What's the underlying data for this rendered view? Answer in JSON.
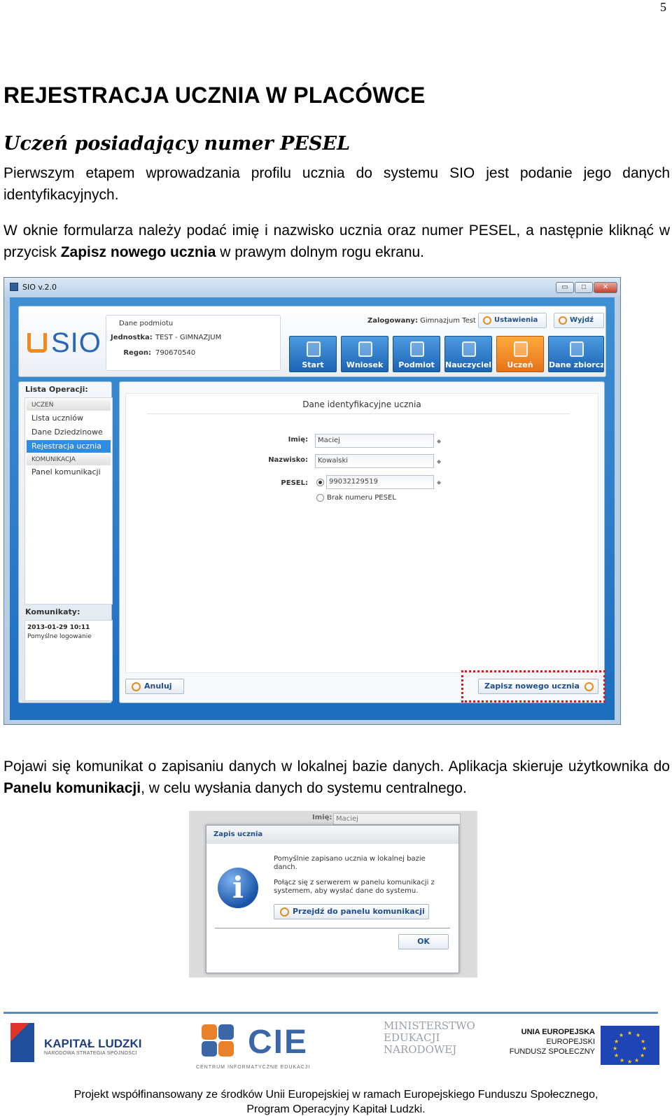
{
  "page_number": "5",
  "title": "REJESTRACJA UCZNIA W PLACÓWCE",
  "subtitle": "Uczeń posiadający numer PESEL",
  "para1": "Pierwszym etapem wprowadzania profilu ucznia do systemu SIO jest podanie jego danych identyfikacyjnych.",
  "para2": {
    "before": "W oknie formularza należy podać imię i nazwisko ucznia oraz numer PESEL, a następnie kliknąć w przycisk ",
    "bold": "Zapisz nowego ucznia",
    "after": " w prawym dolnym rogu ekranu."
  },
  "para3": {
    "before": "Pojawi się komunikat o zapisaniu danych w lokalnej bazie danych. Aplikacja skieruje użytkownika do ",
    "bold": "Panelu komunikacji",
    "after": ", w celu wysłania danych do systemu centralnego."
  },
  "sio": {
    "window_title": "SIO v.2.0",
    "window_buttons": [
      "▭",
      "□",
      "✕"
    ],
    "logo": "SIO",
    "entity": {
      "legend": "Dane podmiotu",
      "unit_label": "Jednostka:",
      "unit_value": "TEST - GIMNAZJUM",
      "regon_label": "Regon:",
      "regon_value": "790670540"
    },
    "logged_label": "Zalogowany:",
    "logged_value": "Gimnazjum Test",
    "settings_btn": "Ustawienia",
    "logout_btn": "Wyjdź",
    "nav": [
      "Start",
      "Wniosek",
      "Podmiot",
      "Nauczyciel",
      "Uczeń",
      "Dane zbiorcze"
    ],
    "nav_active": "Uczeń",
    "ops_title": "Lista Operacji:",
    "ops": {
      "section1": "UCZEŃ",
      "students": "Lista uczniów",
      "domain": "Dane Dziedzinowe",
      "registration": "Rejestracja ucznia",
      "section2": "KOMUNIKACJA",
      "comm_panel": "Panel komunikacji"
    },
    "messages_title": "Komunikaty:",
    "message_time": "2013-01-29 10:11",
    "message_text": "Pomyślne logowanie",
    "form_title": "Dane identyfikacyjne ucznia",
    "first_name_label": "Imię:",
    "first_name_value": "Maciej",
    "last_name_label": "Nazwisko:",
    "last_name_value": "Kowalski",
    "pesel_label": "PESEL:",
    "pesel_value": "99032129519",
    "no_pesel_label": "Brak numeru PESEL",
    "cancel_btn": "Anuluj",
    "save_btn": "Zapisz nowego ucznia",
    "highlight_color": "#e0161a"
  },
  "dialog": {
    "bg_label": "Imię:",
    "bg_value": "Maciej",
    "title": "Zapis ucznia",
    "text1": "Pomyślnie zapisano ucznia w lokalnej bazie danch.",
    "text2": "Połącz się z serwerem w panelu komunikacji z systemem, aby wysłać dane do systemu.",
    "goto_btn": "Przejdź do panelu komunikacji",
    "ok_btn": "OK"
  },
  "footer": {
    "kl_title": "KAPITAŁ LUDZKI",
    "kl_sub": "NARODOWA STRATEGIA SPÓJNOŚCI",
    "cie": "CIE",
    "cie_sub": "CENTRUM INFORMATYCZNE EDUKACJI",
    "men": "MINISTERSTWO\nEDUKACJI\nNARODOWEJ",
    "ue_title": "UNIA EUROPEJSKA",
    "ue_line2": "EUROPEJSKI",
    "ue_line3": "FUNDUSZ SPOŁECZNY",
    "note_line1": "Projekt współfinansowany ze środków Unii Europejskiej w ramach Europejskiego Funduszu Społecznego,",
    "note_line2": "Program Operacyjny Kapitał Ludzki."
  }
}
